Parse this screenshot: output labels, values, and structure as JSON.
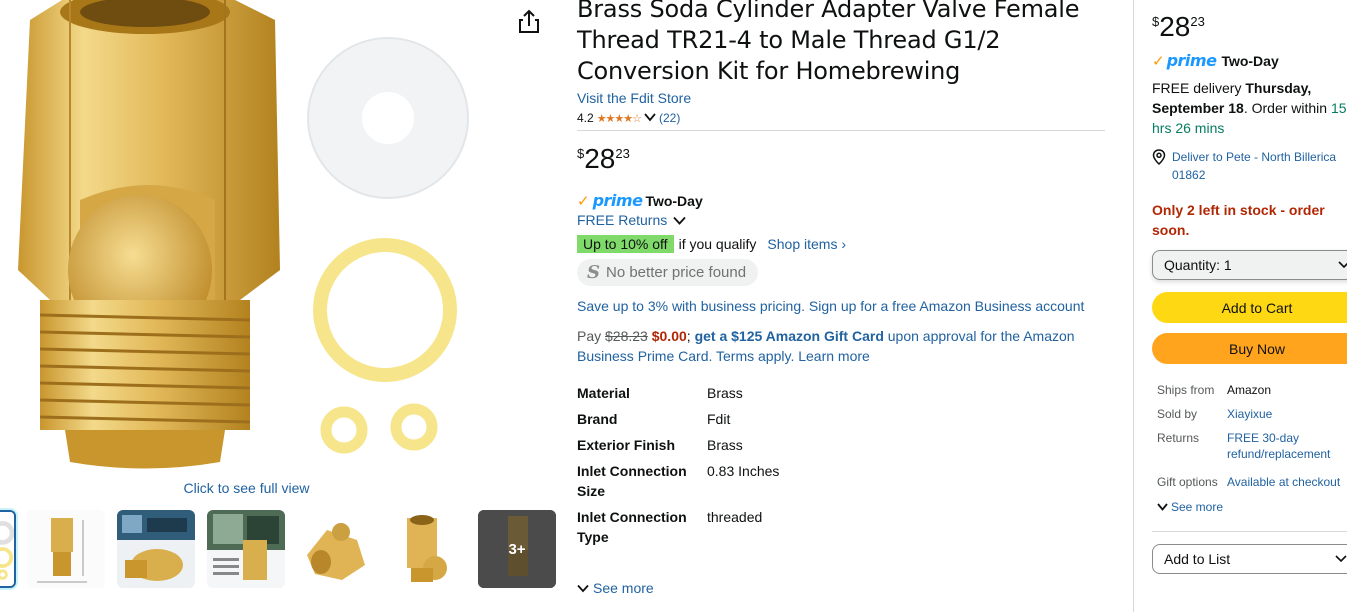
{
  "gallery": {
    "full_view_label": "Click to see full view",
    "more_thumbs_label": "3+"
  },
  "product": {
    "title": "Brass Soda Cylinder Adapter Valve Female Thread TR21-4 to Male Thread G1/2 Conversion Kit for Homebrewing",
    "store_link": "Visit the Fdit Store",
    "rating": "4.2",
    "rating_stars": 4.2,
    "rating_count": "(22)"
  },
  "price": {
    "symbol": "$",
    "whole": "28",
    "fraction": "23"
  },
  "prime": {
    "word": "prime",
    "label": "Two-Day"
  },
  "returns_label": "FREE Returns",
  "promo": {
    "badge": "Up to 10% off",
    "qualify_text": "if you qualify",
    "shop_items": "Shop items"
  },
  "no_better_price": "No better price found",
  "business_pricing": "Save up to 3% with business pricing. Sign up for a free Amazon Business account",
  "gift_card": {
    "pay_label": "Pay",
    "old_price": "$28.23",
    "new_price": "$0.00",
    "separator": ";",
    "offer": "get a $125 Amazon Gift Card",
    "rest": "upon approval for the Amazon Business Prime Card. Terms apply.",
    "learn_more": "Learn more"
  },
  "specs": [
    {
      "key": "Material",
      "value": "Brass"
    },
    {
      "key": "Brand",
      "value": "Fdit"
    },
    {
      "key": "Exterior Finish",
      "value": "Brass"
    },
    {
      "key": "Inlet Connection Size",
      "value": "0.83 Inches"
    },
    {
      "key": "Inlet Connection Type",
      "value": "threaded"
    }
  ],
  "specs_see_more": "See more",
  "buy_box": {
    "price_symbol": "$",
    "price_whole": "28",
    "price_fraction": "23",
    "prime_word": "prime",
    "prime_label": "Two-Day",
    "delivery_prefix": "FREE delivery",
    "delivery_date": "Thursday, September 18",
    "order_within": ". Order within",
    "countdown": "15 hrs 26 mins",
    "deliver_to": "Deliver to Pete - North Billerica 01862",
    "stock_warning": "Only 2 left in stock - order soon.",
    "quantity_label": "Quantity:",
    "quantity_value": "1",
    "add_to_cart": "Add to Cart",
    "buy_now": "Buy Now",
    "info": [
      {
        "key": "Ships from",
        "value": "Amazon",
        "link": false
      },
      {
        "key": "Sold by",
        "value": "Xiayixue",
        "link": true
      },
      {
        "key": "Returns",
        "value": "FREE 30-day refund/replacement",
        "link": true
      },
      {
        "key": "Gift options",
        "value": "Available at checkout",
        "link": true
      }
    ],
    "see_more": "See more",
    "add_to_list": "Add to List"
  },
  "colors": {
    "link": "#2162a1",
    "price_red": "#b12704",
    "cart_yellow": "#ffd814",
    "buy_orange": "#ffa41c",
    "promo_green": "#7fda69",
    "prime_blue": "#1a98ff",
    "brass": "#d8b34a"
  },
  "icons": [
    "share-icon",
    "chevron-down-icon",
    "location-pin-icon",
    "star-icon"
  ]
}
